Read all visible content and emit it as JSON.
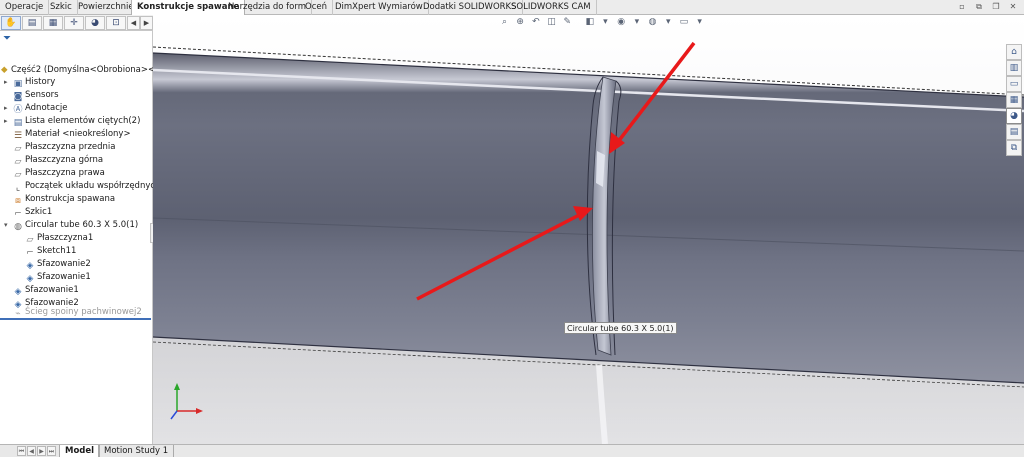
{
  "command_tabs": [
    "Operacje",
    "Szkic",
    "Powierzchnie",
    "Konstrukcje spawane",
    "Narzędzia do form",
    "Oceń",
    "DimXpert Wymiarów",
    "Dodatki SOLIDWORKS",
    "SOLIDWORKS CAM"
  ],
  "active_command_tab": "Konstrukcje spawane",
  "feature_tree": {
    "root": "Część2  (Domyślna<Obrobiona><<Do",
    "items": [
      {
        "label": "History"
      },
      {
        "label": "Sensors"
      },
      {
        "label": "Adnotacje"
      },
      {
        "label": "Lista elementów ciętych(2)"
      },
      {
        "label": "Materiał <nieokreślony>"
      },
      {
        "label": "Płaszczyzna przednia"
      },
      {
        "label": "Płaszczyzna górna"
      },
      {
        "label": "Płaszczyzna prawa"
      },
      {
        "label": "Początek układu współrzędnych"
      },
      {
        "label": "Konstrukcja spawana"
      },
      {
        "label": "Szkic1"
      },
      {
        "label": "Circular tube 60.3 X 5.0(1)"
      },
      {
        "label": "Płaszczyzna1"
      },
      {
        "label": "Sketch11"
      },
      {
        "label": "Sfazowanie2"
      },
      {
        "label": "Sfazowanie1"
      },
      {
        "label": "Sfazowanie1"
      },
      {
        "label": "Sfazowanie2"
      },
      {
        "label": "Ścieg spoiny pachwinowej2"
      }
    ]
  },
  "viewport": {
    "tooltip": "Circular tube 60.3 X 5.0(1)"
  },
  "bottom_tabs": [
    "Model",
    "Motion Study 1"
  ],
  "active_bottom_tab": "Model",
  "colors": {
    "annotation_arrow": "#e8191a",
    "tube_body": "#5a5e70",
    "accent": "#2c62a6"
  },
  "icons": [
    "filter-icon",
    "feature-manager-icon",
    "property-manager-icon",
    "configuration-manager-icon",
    "dimxpert-icon",
    "display-manager-icon",
    "task-pane-home-icon",
    "design-library-icon",
    "file-explorer-icon",
    "view-palette-icon",
    "appearances-icon",
    "custom-properties-icon",
    "solidworks-forum-icon"
  ]
}
